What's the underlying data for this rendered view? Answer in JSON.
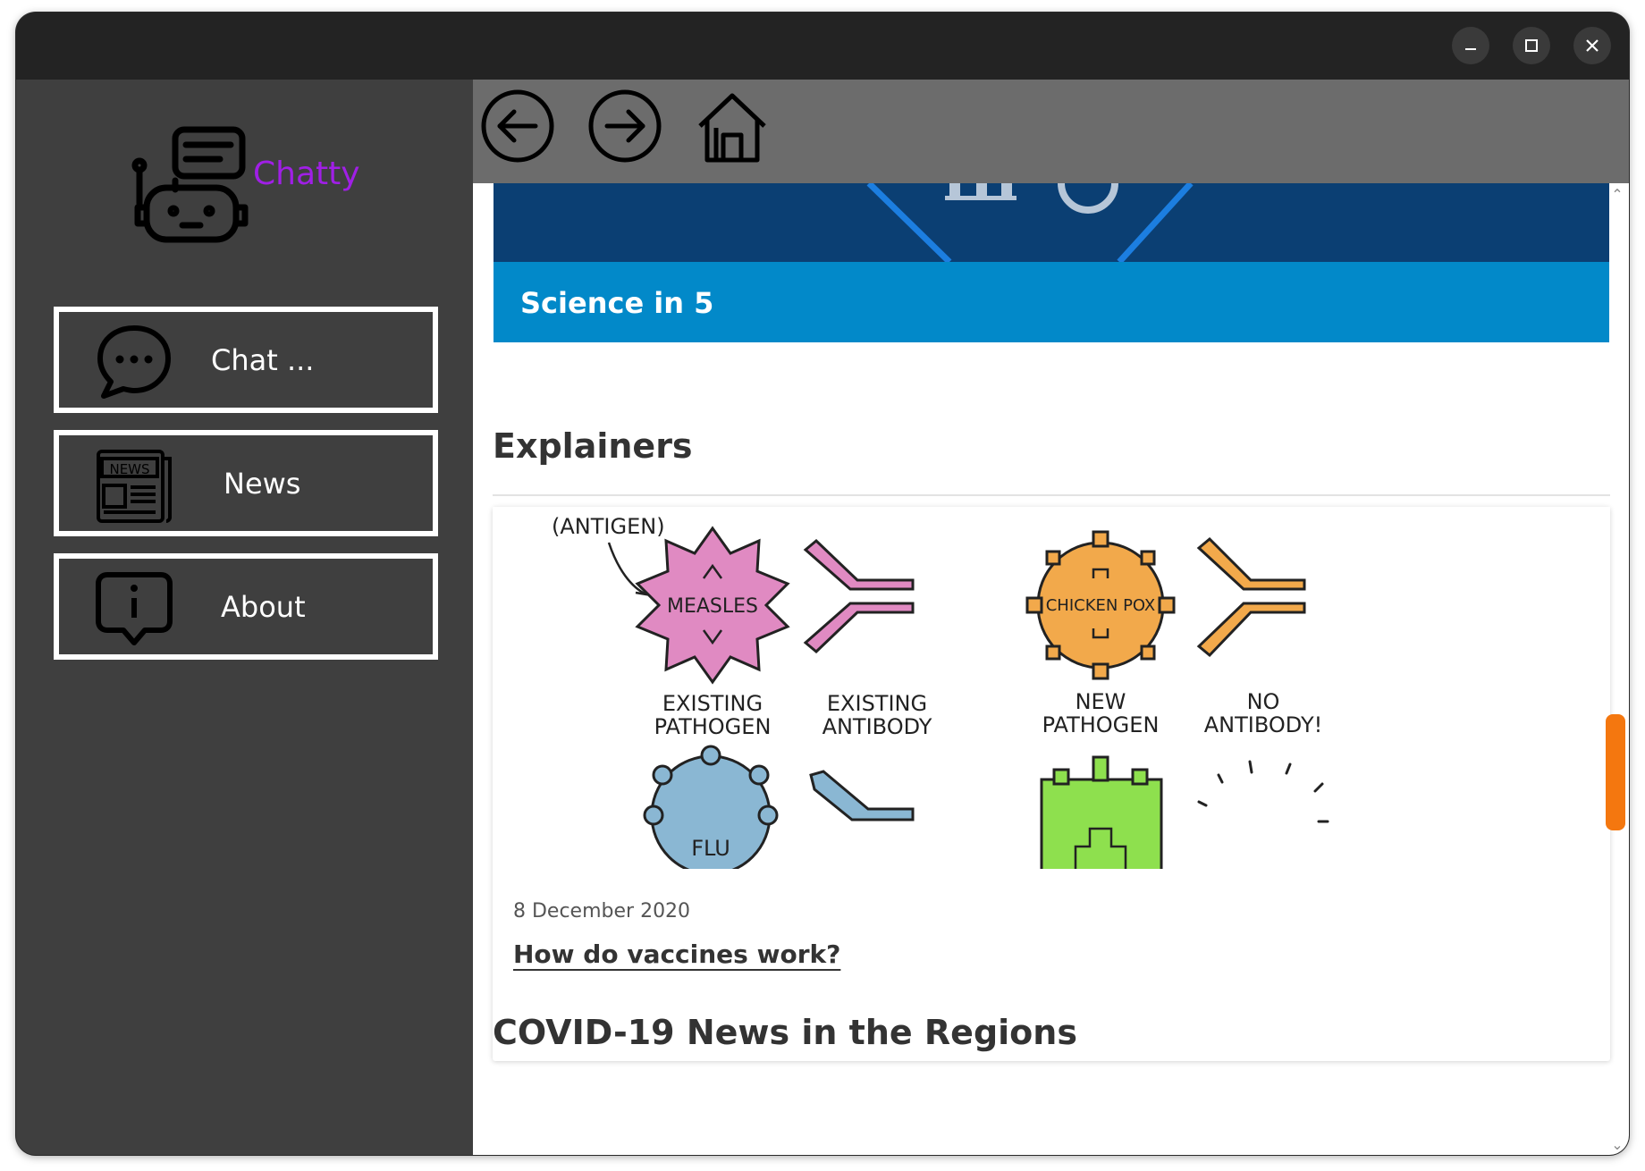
{
  "window": {
    "controls": {
      "minimize": "minimize-icon",
      "maximize": "maximize-icon",
      "close": "close-icon"
    }
  },
  "sidebar": {
    "app_name": "Chatty",
    "logo_icon": "robot-chat-icon",
    "nav_items": [
      {
        "label": "Chat ...",
        "icon": "chat-bubble-icon"
      },
      {
        "label": "News",
        "icon": "newspaper-icon"
      },
      {
        "label": "About",
        "icon": "info-bubble-icon"
      }
    ]
  },
  "toolbar": {
    "back_icon": "arrow-left-circle-icon",
    "forward_icon": "arrow-right-circle-icon",
    "home_icon": "home-icon"
  },
  "page": {
    "banner": {
      "title": "Science in 5"
    },
    "explainers": {
      "heading": "Explainers",
      "card": {
        "image_labels": {
          "antigen": "(ANTIGEN)",
          "measles": "MEASLES",
          "chicken_pox": "CHICKEN POX",
          "flu": "FLU",
          "existing_pathogen": [
            "EXISTING",
            "PATHOGEN"
          ],
          "existing_antibody": [
            "EXISTING",
            "ANTIBODY"
          ],
          "new_pathogen": [
            "NEW",
            "PATHOGEN"
          ],
          "no_antibody": [
            "NO",
            "ANTIBODY!"
          ]
        },
        "date": "8 December 2020",
        "title": "How do vaccines work?"
      }
    },
    "regions": {
      "heading": "COVID-19 News in the Regions"
    }
  },
  "colors": {
    "accent": "#a01fe6",
    "titlebar": "#232323",
    "sidebar": "#3f3f3f",
    "toolbar": "#6c6c6c",
    "banner_blue": "#0289c9",
    "scroll_thumb": "#f4770f"
  }
}
